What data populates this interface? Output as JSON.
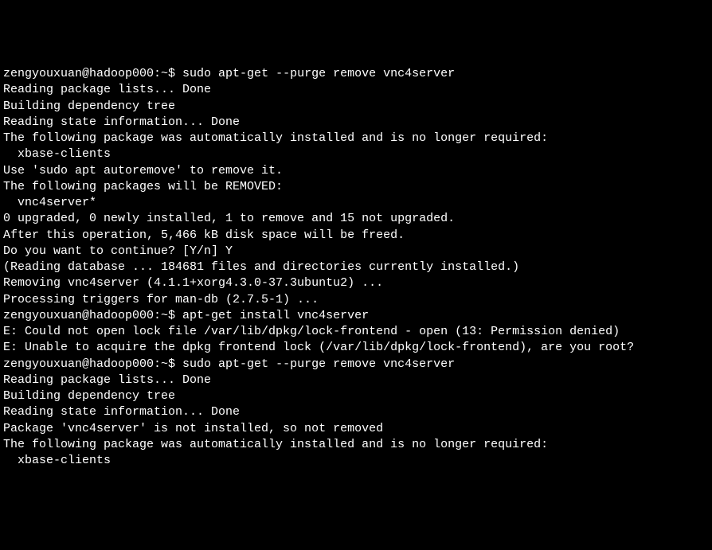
{
  "terminal": {
    "lines": [
      {
        "type": "prompt-command",
        "prompt": "zengyouxuan@hadoop000:~$ ",
        "command": "sudo apt-get --purge remove vnc4server"
      },
      {
        "type": "output",
        "text": "Reading package lists... Done"
      },
      {
        "type": "output",
        "text": "Building dependency tree"
      },
      {
        "type": "output",
        "text": "Reading state information... Done"
      },
      {
        "type": "output",
        "text": "The following package was automatically installed and is no longer required:"
      },
      {
        "type": "output",
        "text": "  xbase-clients"
      },
      {
        "type": "output",
        "text": "Use 'sudo apt autoremove' to remove it."
      },
      {
        "type": "output",
        "text": "The following packages will be REMOVED:"
      },
      {
        "type": "output",
        "text": "  vnc4server*"
      },
      {
        "type": "output",
        "text": "0 upgraded, 0 newly installed, 1 to remove and 15 not upgraded."
      },
      {
        "type": "output",
        "text": "After this operation, 5,466 kB disk space will be freed."
      },
      {
        "type": "output",
        "text": "Do you want to continue? [Y/n] Y"
      },
      {
        "type": "output",
        "text": "(Reading database ... 184681 files and directories currently installed.)"
      },
      {
        "type": "output",
        "text": "Removing vnc4server (4.1.1+xorg4.3.0-37.3ubuntu2) ..."
      },
      {
        "type": "output",
        "text": "Processing triggers for man-db (2.7.5-1) ..."
      },
      {
        "type": "prompt-command",
        "prompt": "zengyouxuan@hadoop000:~$ ",
        "command": "apt-get install vnc4server"
      },
      {
        "type": "output",
        "text": "E: Could not open lock file /var/lib/dpkg/lock-frontend - open (13: Permission denied)"
      },
      {
        "type": "output",
        "text": "E: Unable to acquire the dpkg frontend lock (/var/lib/dpkg/lock-frontend), are you root?"
      },
      {
        "type": "prompt-command",
        "prompt": "zengyouxuan@hadoop000:~$ ",
        "command": "sudo apt-get --purge remove vnc4server"
      },
      {
        "type": "output",
        "text": "Reading package lists... Done"
      },
      {
        "type": "output",
        "text": "Building dependency tree"
      },
      {
        "type": "output",
        "text": "Reading state information... Done"
      },
      {
        "type": "output",
        "text": "Package 'vnc4server' is not installed, so not removed"
      },
      {
        "type": "output",
        "text": "The following package was automatically installed and is no longer required:"
      },
      {
        "type": "output",
        "text": "  xbase-clients"
      }
    ]
  }
}
